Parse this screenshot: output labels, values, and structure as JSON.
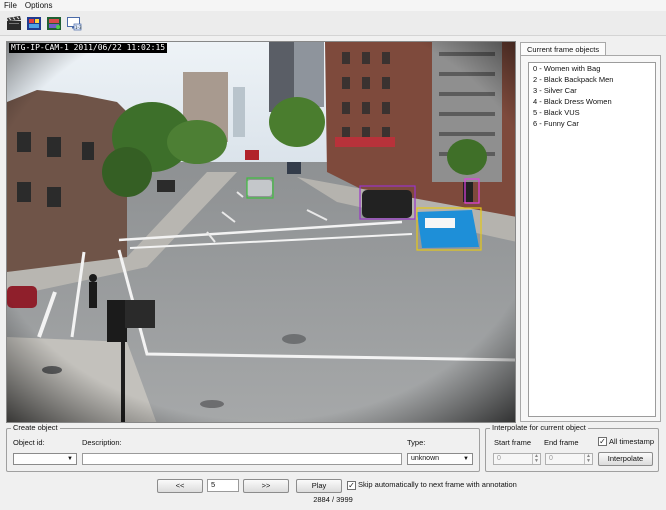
{
  "menu": {
    "file": "File",
    "options": "Options"
  },
  "toolbar": {
    "buttons": [
      {
        "icon": "clapperboard-icon"
      },
      {
        "icon": "film-frames-icon"
      },
      {
        "icon": "film-edit-icon"
      },
      {
        "icon": "monitor-counter-icon"
      }
    ]
  },
  "video": {
    "camera_label": "MTG-IP-CAM-1  2011/06/22 11:02:15",
    "annotations": [
      {
        "object_id": 3,
        "color": "#3fbf3f"
      },
      {
        "object_id": 4,
        "color": "#e040e0"
      },
      {
        "object_id": 5,
        "color": "#9a35c8"
      },
      {
        "object_id": 6,
        "color": "#e7c816"
      }
    ]
  },
  "current_frame": {
    "tab_label": "Current frame objects",
    "objects": [
      "0 - Women with Bag",
      "2 - Black Backpack Men",
      "3 - Silver Car",
      "4 - Black Dress Women",
      "5 - Black VUS",
      "6 - Funny Car"
    ]
  },
  "create_object": {
    "title": "Create object",
    "object_id_label": "Object id:",
    "object_id_value": "",
    "description_label": "Description:",
    "description_value": "",
    "type_label": "Type:",
    "type_value": "unknown"
  },
  "interpolate": {
    "title": "Interpolate for current object",
    "start_label": "Start frame",
    "end_label": "End frame",
    "start_value": "0",
    "end_value": "0",
    "all_timestamp_label": "All timestamp",
    "all_timestamp_checked": true,
    "interpolate_button": "Interpolate"
  },
  "navigation": {
    "prev_label": "<<",
    "frame_step": "5",
    "next_label": ">>",
    "play_label": "Play",
    "skip_label": "Skip automatically to next frame with annotation",
    "skip_checked": true,
    "frame_counter": "2884 / 3999"
  },
  "colors": {
    "window_bg": "#f0f0f0",
    "purple_box": "#9a35c8",
    "yellow_box": "#e7c816",
    "green_box": "#3fbf3f",
    "pink_box": "#e040e0"
  }
}
